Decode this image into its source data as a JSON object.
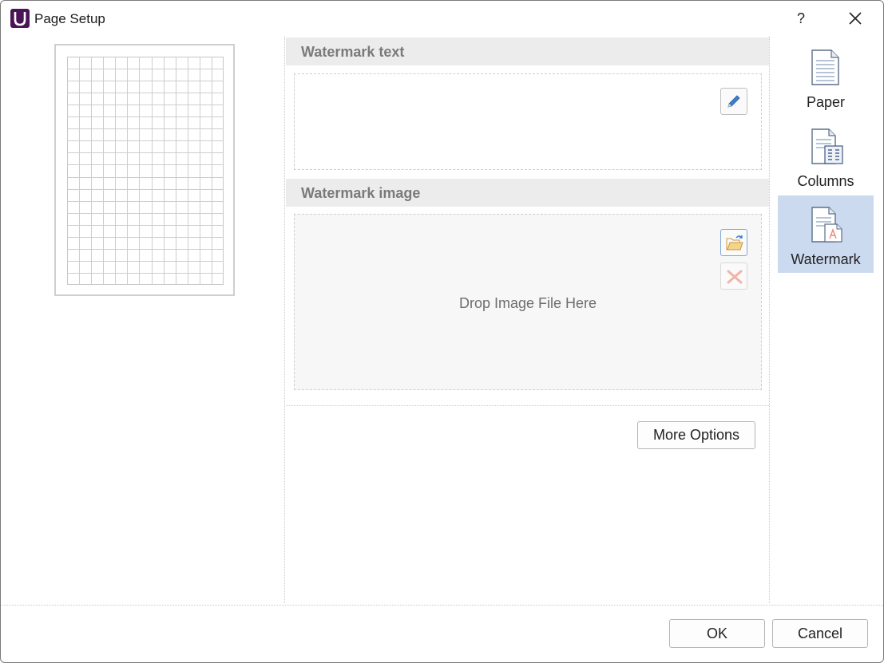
{
  "window": {
    "title": "Page Setup",
    "help_label": "?"
  },
  "watermark_text": {
    "header": "Watermark text"
  },
  "watermark_image": {
    "header": "Watermark image",
    "drop_hint": "Drop Image File Here"
  },
  "more_options_label": "More Options",
  "nav": {
    "items": [
      {
        "label": "Paper",
        "icon": "paper-icon",
        "active": false
      },
      {
        "label": "Columns",
        "icon": "columns-icon",
        "active": false
      },
      {
        "label": "Watermark",
        "icon": "watermark-icon",
        "active": true
      }
    ]
  },
  "footer": {
    "ok_label": "OK",
    "cancel_label": "Cancel"
  },
  "colors": {
    "accent_active": "#ccdaf0",
    "brand": "#4b1456"
  }
}
